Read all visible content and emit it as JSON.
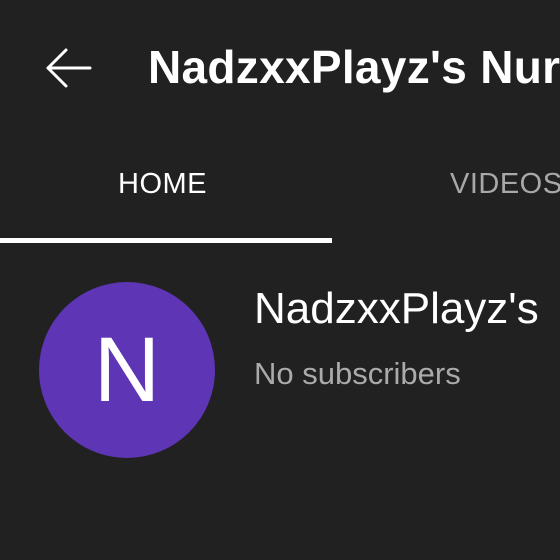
{
  "header": {
    "back_icon": "arrow-left-icon",
    "title": "NadzxxPlayz's Nur"
  },
  "tabs": [
    {
      "label": "HOME",
      "selected": true
    },
    {
      "label": "VIDEOS",
      "selected": false
    }
  ],
  "channel": {
    "avatar_letter": "N",
    "avatar_color": "#5d35b5",
    "name": "NadzxxPlayz's",
    "subscribers": "No subscribers"
  },
  "colors": {
    "background": "#212121",
    "text_primary": "#ffffff",
    "text_secondary": "#aaaaaa"
  }
}
